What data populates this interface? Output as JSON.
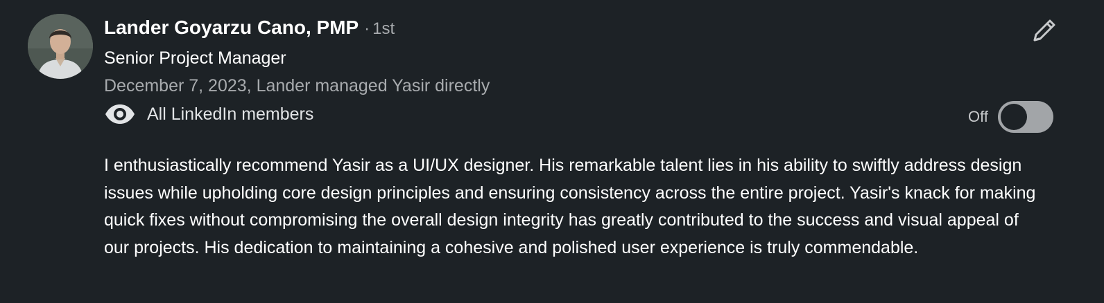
{
  "recommender": {
    "name": "Lander Goyarzu Cano, PMP",
    "degree_separator": "·",
    "degree": "1st",
    "headline": "Senior Project Manager",
    "meta": "December 7, 2023, Lander managed Yasir directly"
  },
  "visibility": {
    "icon": "eye-icon",
    "label": "All LinkedIn members"
  },
  "toggle": {
    "state_label": "Off",
    "on": false
  },
  "actions": {
    "edit_icon": "pencil-icon"
  },
  "recommendation": {
    "text": "I enthusiastically recommend Yasir as a UI/UX designer. His remarkable talent lies in his ability to swiftly address design issues while upholding core design principles and ensuring consistency across the entire project. Yasir's knack for making quick fixes without compromising the overall design integrity has greatly contributed to the success and visual appeal of our projects. His dedication to maintaining a cohesive and polished user experience is truly commendable."
  },
  "colors": {
    "background": "#1d2226",
    "primary_text": "#ffffff",
    "secondary_text": "#a8abae",
    "toggle_track": "#a2a5a8"
  }
}
